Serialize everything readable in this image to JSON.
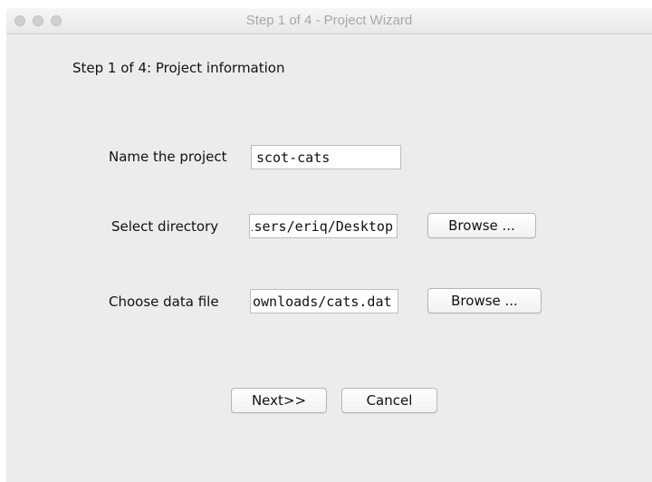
{
  "window": {
    "title": "Step 1 of 4 - Project Wizard",
    "traffic_lights": [
      "close",
      "minimize",
      "zoom"
    ]
  },
  "wizard": {
    "heading": "Step 1 of 4: Project information",
    "project_name": {
      "label": "Name the project",
      "value": "scot-cats"
    },
    "directory": {
      "label": "Select directory",
      "value": "lsers/eriq/Desktop",
      "browse_label": "Browse ..."
    },
    "data_file": {
      "label": "Choose data file",
      "value": "ownloads/cats.dat",
      "browse_label": "Browse ..."
    },
    "next_label": "Next>>",
    "cancel_label": "Cancel"
  },
  "colors": {
    "window_background": "#ececec",
    "title_text": "#a8a8a8",
    "traffic_light": "#d0d0d0"
  }
}
